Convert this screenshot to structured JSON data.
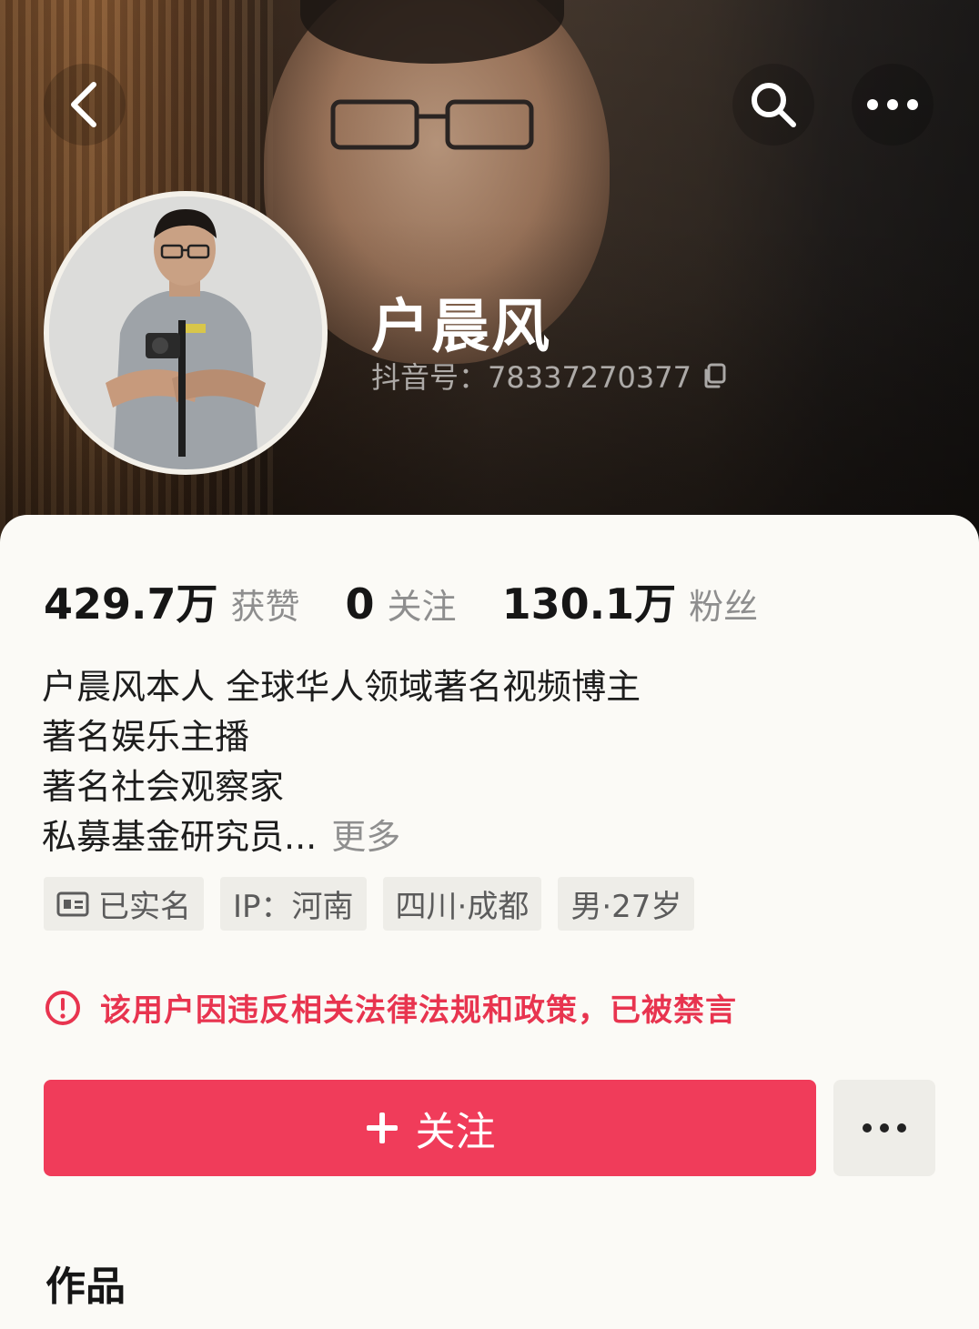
{
  "profile": {
    "name": "户晨风",
    "douyin_id": "抖音号：78337270377"
  },
  "stats": [
    {
      "value": "429.7万",
      "label": "获赞"
    },
    {
      "value": "0",
      "label": "关注"
    },
    {
      "value": "130.1万",
      "label": "粉丝"
    }
  ],
  "bio": {
    "lines": [
      "户晨风本人  全球华人领域著名视频博主",
      "著名娱乐主播",
      "著名社会观察家",
      "私募基金研究员..."
    ],
    "more_label": "更多"
  },
  "tags": [
    {
      "label": "已实名",
      "icon": "id-card-icon"
    },
    {
      "label": "IP：河南"
    },
    {
      "label": "四川·成都"
    },
    {
      "label": "男·27岁"
    }
  ],
  "warning": {
    "text": "该用户因违反相关法律法规和政策，已被禁言",
    "color": "#e8344f"
  },
  "actions": {
    "follow_label": "关注",
    "follow_color": "#f03c5a"
  },
  "sections": {
    "works_title": "作品"
  },
  "icons": {
    "back": "chevron-left-icon",
    "search": "search-icon",
    "more": "more-dots-icon",
    "copy": "copy-icon",
    "warning": "exclamation-circle-icon",
    "plus": "plus-icon"
  }
}
